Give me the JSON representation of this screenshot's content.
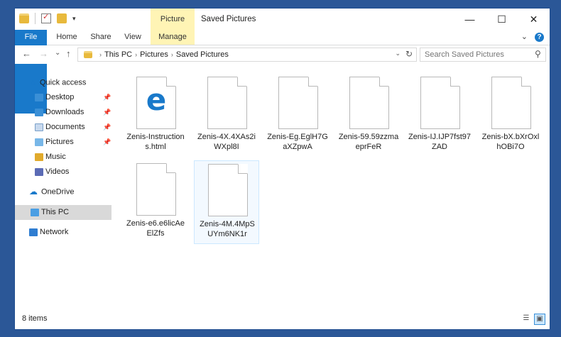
{
  "window": {
    "title": "Saved Pictures",
    "context_tab_group": "Picture Tools",
    "controls": {
      "minimize": "—",
      "maximize": "☐",
      "close": "✕"
    }
  },
  "quick_access_toolbar": {
    "dropdown": "▾"
  },
  "ribbon": {
    "tabs": [
      "File",
      "Home",
      "Share",
      "View",
      "Manage"
    ],
    "expand_glyph": "⌄",
    "help_glyph": "?"
  },
  "navigation": {
    "back": "←",
    "forward": "→",
    "history": "⌄",
    "up": "↑",
    "breadcrumb": [
      "This PC",
      "Pictures",
      "Saved Pictures"
    ],
    "crumb_separator": "›",
    "dropdown": "⌄",
    "refresh": "↻",
    "search_placeholder": "Search Saved Pictures",
    "search_icon": "⚲"
  },
  "nav_pane": {
    "quick_access": "Quick access",
    "items": [
      {
        "label": "Desktop",
        "icon": "desktop-folder",
        "pinned": true
      },
      {
        "label": "Downloads",
        "icon": "downloads-folder",
        "pinned": true
      },
      {
        "label": "Documents",
        "icon": "documents-folder",
        "pinned": true
      },
      {
        "label": "Pictures",
        "icon": "pictures-folder",
        "pinned": true
      },
      {
        "label": "Music",
        "icon": "music-folder",
        "pinned": false
      },
      {
        "label": "Videos",
        "icon": "videos-folder",
        "pinned": false
      }
    ],
    "onedrive": "OneDrive",
    "this_pc": "This PC",
    "network": "Network",
    "pin_glyph": "📌"
  },
  "files": [
    {
      "line1": "Zenis-Instruction",
      "line2": "s.html",
      "icon": "edge-html-file"
    },
    {
      "line1": "Zenis-4X.4XAs2i",
      "line2": "WXpl8I",
      "icon": "blank-file"
    },
    {
      "line1": "Zenis-Eg.EglH7G",
      "line2": "aXZpwA",
      "icon": "blank-file"
    },
    {
      "line1": "Zenis-59.59zzma",
      "line2": "eprFeR",
      "icon": "blank-file"
    },
    {
      "line1": "Zenis-IJ.IJP7fst97",
      "line2": "ZAD",
      "icon": "blank-file"
    },
    {
      "line1": "Zenis-bX.bXrOxl",
      "line2": "hOBi7O",
      "icon": "blank-file"
    },
    {
      "line1": "Zenis-e6.e6licAe",
      "line2": "ElZfs",
      "icon": "blank-file"
    },
    {
      "line1": "Zenis-4M.4MpS",
      "line2": "UYm6NK1r",
      "icon": "blank-file"
    }
  ],
  "status": {
    "item_count": "8 items"
  },
  "colors": {
    "accent": "#1979ca",
    "picture_tools": "#fff4b5",
    "desktop_bg": "#2b5797"
  }
}
